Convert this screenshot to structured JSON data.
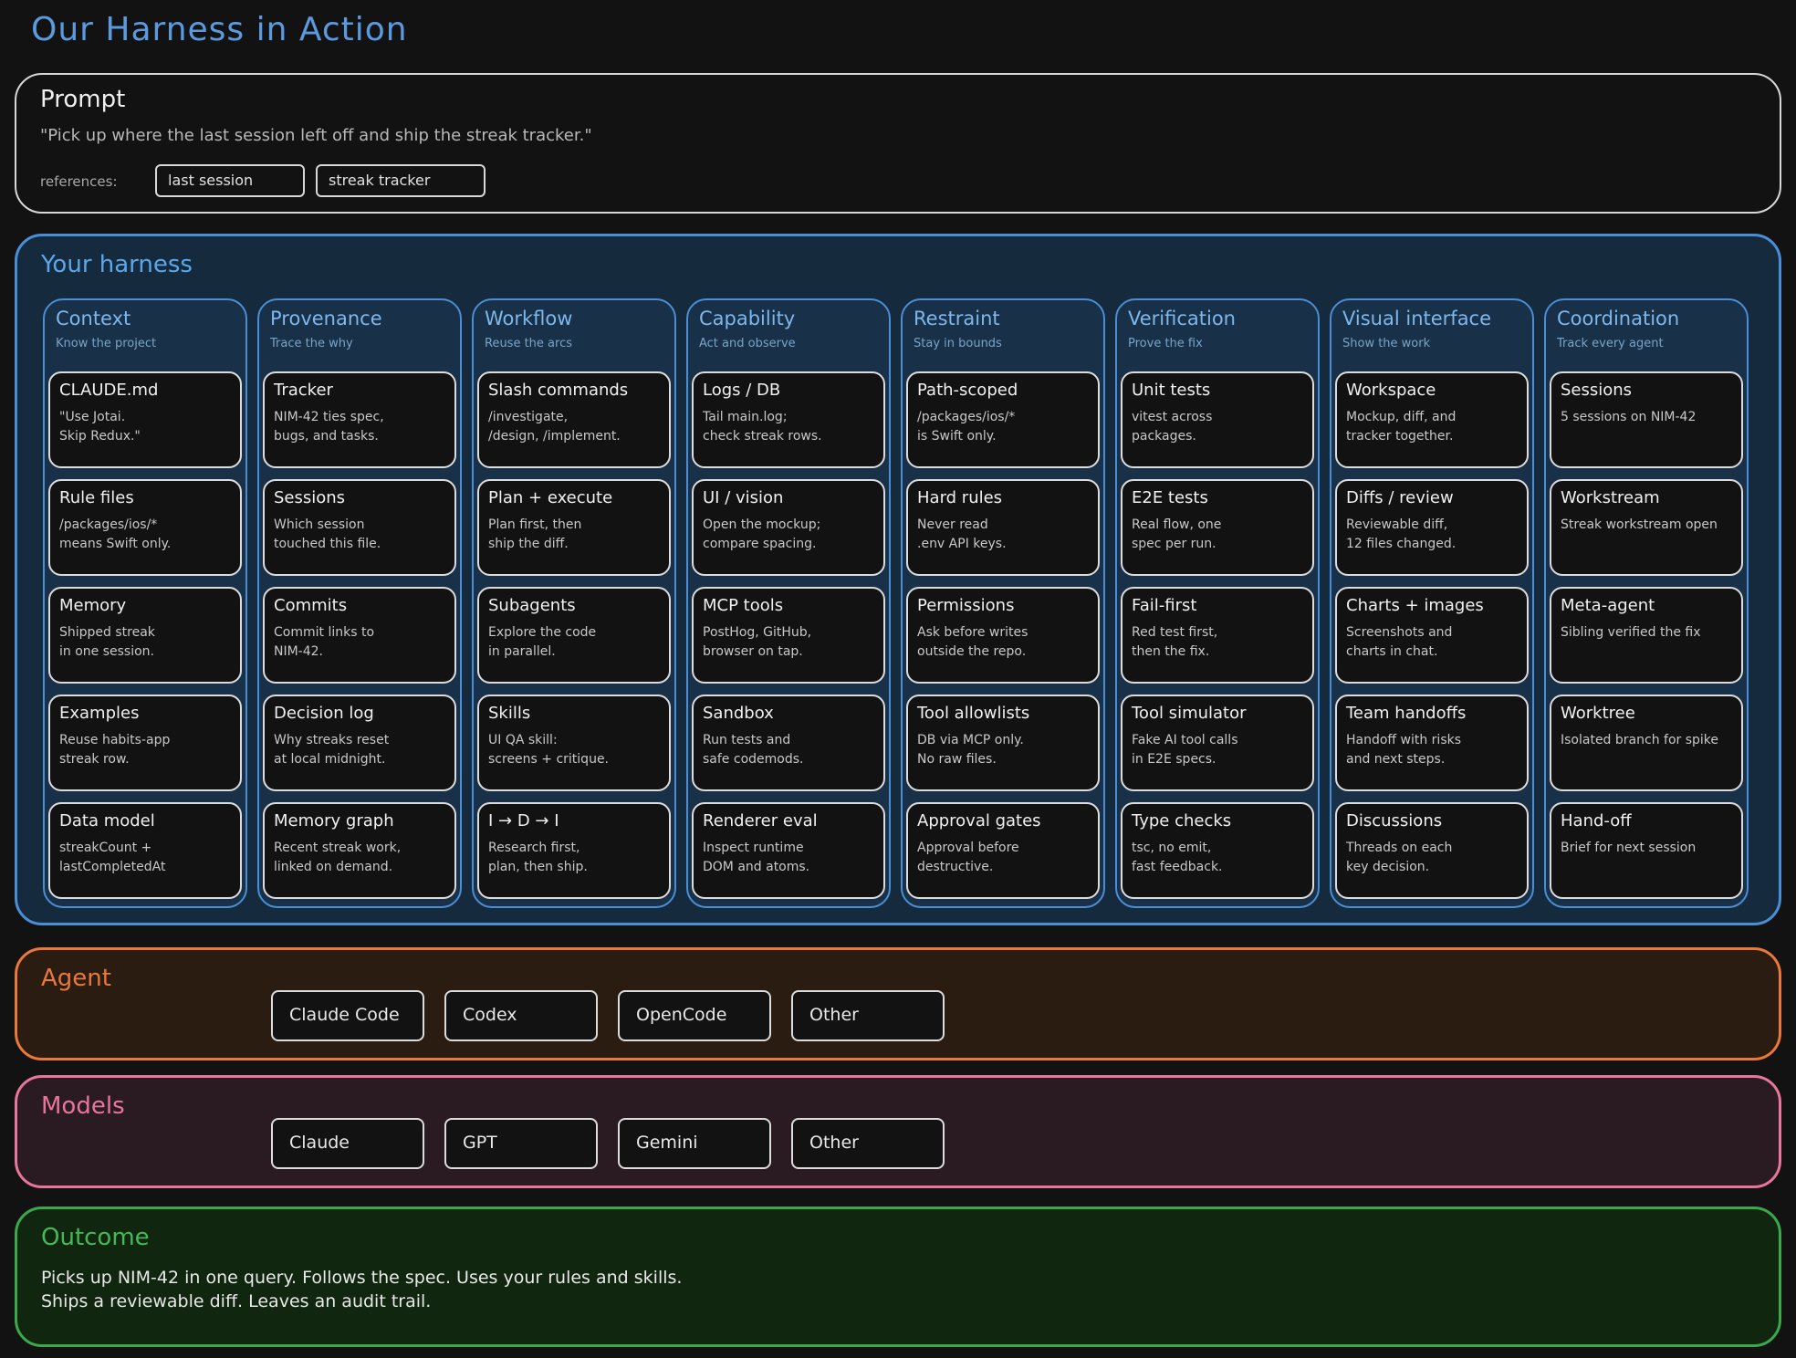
{
  "title": "Our Harness in Action",
  "prompt": {
    "title": "Prompt",
    "quote": "\"Pick up where the last session left off and ship the streak tracker.\"",
    "references_label": "references:",
    "references": [
      "last session",
      "streak tracker"
    ]
  },
  "harness": {
    "title": "Your harness",
    "columns": [
      {
        "title": "Context",
        "subtitle": "Know the project",
        "cards": [
          {
            "title": "CLAUDE.md",
            "desc": "\"Use Jotai.\nSkip Redux.\""
          },
          {
            "title": "Rule files",
            "desc": "/packages/ios/*\nmeans Swift only."
          },
          {
            "title": "Memory",
            "desc": "Shipped streak\nin one session."
          },
          {
            "title": "Examples",
            "desc": "Reuse habits-app\nstreak row."
          },
          {
            "title": "Data model",
            "desc": "streakCount +\nlastCompletedAt"
          }
        ]
      },
      {
        "title": "Provenance",
        "subtitle": "Trace the why",
        "cards": [
          {
            "title": "Tracker",
            "desc": "NIM-42 ties spec,\nbugs, and tasks."
          },
          {
            "title": "Sessions",
            "desc": "Which session\ntouched this file."
          },
          {
            "title": "Commits",
            "desc": "Commit links to\nNIM-42."
          },
          {
            "title": "Decision log",
            "desc": "Why streaks reset\nat local midnight."
          },
          {
            "title": "Memory graph",
            "desc": "Recent streak work,\nlinked on demand."
          }
        ]
      },
      {
        "title": "Workflow",
        "subtitle": "Reuse the arcs",
        "cards": [
          {
            "title": "Slash commands",
            "desc": "/investigate,\n/design, /implement."
          },
          {
            "title": "Plan + execute",
            "desc": "Plan first, then\nship the diff."
          },
          {
            "title": "Subagents",
            "desc": "Explore the code\nin parallel."
          },
          {
            "title": "Skills",
            "desc": "UI QA skill:\nscreens + critique."
          },
          {
            "title": "I → D → I",
            "desc": "Research first,\nplan, then ship."
          }
        ]
      },
      {
        "title": "Capability",
        "subtitle": "Act and observe",
        "cards": [
          {
            "title": "Logs / DB",
            "desc": "Tail main.log;\ncheck streak rows."
          },
          {
            "title": "UI / vision",
            "desc": "Open the mockup;\ncompare spacing."
          },
          {
            "title": "MCP tools",
            "desc": "PostHog, GitHub,\nbrowser on tap."
          },
          {
            "title": "Sandbox",
            "desc": "Run tests and\nsafe codemods."
          },
          {
            "title": "Renderer eval",
            "desc": "Inspect runtime\nDOM and atoms."
          }
        ]
      },
      {
        "title": "Restraint",
        "subtitle": "Stay in bounds",
        "cards": [
          {
            "title": "Path-scoped",
            "desc": "/packages/ios/*\nis Swift only."
          },
          {
            "title": "Hard rules",
            "desc": "Never read\n.env API keys."
          },
          {
            "title": "Permissions",
            "desc": "Ask before writes\noutside the repo."
          },
          {
            "title": "Tool allowlists",
            "desc": "DB via MCP only.\nNo raw files."
          },
          {
            "title": "Approval gates",
            "desc": "Approval before\ndestructive."
          }
        ]
      },
      {
        "title": "Verification",
        "subtitle": "Prove the fix",
        "cards": [
          {
            "title": "Unit tests",
            "desc": "vitest across\npackages."
          },
          {
            "title": "E2E tests",
            "desc": "Real flow, one\nspec per run."
          },
          {
            "title": "Fail-first",
            "desc": "Red test first,\nthen the fix."
          },
          {
            "title": "Tool simulator",
            "desc": "Fake AI tool calls\nin E2E specs."
          },
          {
            "title": "Type checks",
            "desc": "tsc, no emit,\nfast feedback."
          }
        ]
      },
      {
        "title": "Visual interface",
        "subtitle": "Show the work",
        "cards": [
          {
            "title": "Workspace",
            "desc": "Mockup, diff, and\ntracker together."
          },
          {
            "title": "Diffs / review",
            "desc": "Reviewable diff,\n12 files changed."
          },
          {
            "title": "Charts + images",
            "desc": "Screenshots and\ncharts in chat."
          },
          {
            "title": "Team handoffs",
            "desc": "Handoff with risks\nand next steps."
          },
          {
            "title": "Discussions",
            "desc": "Threads on each\nkey decision."
          }
        ]
      },
      {
        "title": "Coordination",
        "subtitle": "Track every agent",
        "cards": [
          {
            "title": "Sessions",
            "desc": "5 sessions on NIM-42"
          },
          {
            "title": "Workstream",
            "desc": "Streak workstream open"
          },
          {
            "title": "Meta-agent",
            "desc": "Sibling verified the fix"
          },
          {
            "title": "Worktree",
            "desc": "Isolated branch for spike"
          },
          {
            "title": "Hand-off",
            "desc": "Brief for next session"
          }
        ]
      }
    ]
  },
  "agent": {
    "title": "Agent",
    "options": [
      "Claude Code",
      "Codex",
      "OpenCode",
      "Other"
    ]
  },
  "models": {
    "title": "Models",
    "options": [
      "Claude",
      "GPT",
      "Gemini",
      "Other"
    ]
  },
  "outcome": {
    "title": "Outcome",
    "text": "Picks up NIM-42 in one query. Follows the spec. Uses your rules and skills.\nShips a reviewable diff. Leaves an audit trail."
  },
  "colors": {
    "harness_accent": "#4a8fd6",
    "agent_accent": "#e8793a",
    "models_accent": "#e8769a",
    "outcome_accent": "#3ba84c"
  }
}
